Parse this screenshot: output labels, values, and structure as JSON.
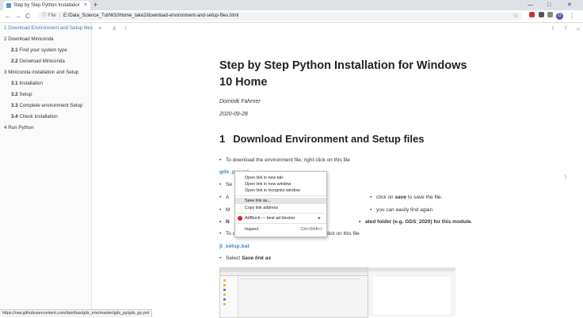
{
  "browser": {
    "tab_title": "Step by Step Python Installation for",
    "tab_close": "×",
    "new_tab": "+",
    "win_min": "—",
    "win_max": "□",
    "win_close": "✕",
    "back": "←",
    "forward": "→",
    "reload": "C",
    "info": "ⓘ",
    "file_label": "File",
    "url": "E:/Data_Science_Tut/W10Home_take2/download-environment-and-setup-files.html",
    "star": "☆",
    "avatar_letter": "D",
    "menu": "⋮"
  },
  "sidebar": {
    "items": [
      {
        "num": "1",
        "label": "Download Environment and Setup files"
      },
      {
        "num": "2",
        "label": "Download Miniconda"
      },
      {
        "num": "2.1",
        "label": "Find your system type"
      },
      {
        "num": "2.2",
        "label": "Donwload Miniconda"
      },
      {
        "num": "3",
        "label": "Miniconda installation and Setup"
      },
      {
        "num": "3.1",
        "label": "Installation"
      },
      {
        "num": "3.2",
        "label": "Setup"
      },
      {
        "num": "3.3",
        "label": "Complete environment Setup"
      },
      {
        "num": "3.4",
        "label": "Check installation"
      },
      {
        "num": "4",
        "label": "Run Python"
      }
    ]
  },
  "book_header": {
    "menu_icon": "≡",
    "font_icon": "A",
    "info_icon": "i",
    "twitter_icon": "t",
    "facebook_icon": "f",
    "share_icon": "≺"
  },
  "content": {
    "title": "Step by Step Python Installation for Windows 10 Home",
    "author": "Dominik Fahrner",
    "date": "2020-09-28",
    "h1_num": "1",
    "h1": "Download Environment and Setup files",
    "bullet1": "To download the environment file, right click on this file",
    "link1": "gds_py.yml",
    "bullet2_start": "Se",
    "bullet3_start": "A",
    "bullet3_end_a": "click on ",
    "bullet3_end_b": "save",
    "bullet3_end_c": " to save the file.",
    "bullet4_start": "M",
    "bullet4_end": "you can easily find again",
    "bullet5_start": "N",
    "bullet5_end": "ated folder (e.g. GDS_2020) for this module.",
    "bullet6": "To download the jupyter lab setup file, right click on this file",
    "link2": "jl_setup.bat",
    "bullet7_a": "Select ",
    "bullet7_b": "Save link as",
    "next_arrow": "›"
  },
  "context_menu": {
    "items": [
      {
        "label": "Open link in new tab",
        "kbd": ""
      },
      {
        "label": "Open link in new window",
        "kbd": ""
      },
      {
        "label": "Open link in incognito window",
        "kbd": ""
      },
      {
        "label": "Save link as...",
        "kbd": ""
      },
      {
        "label": "Copy link address",
        "kbd": ""
      },
      {
        "label": "AdBlock — best ad blocker",
        "kbd": "►"
      },
      {
        "label": "Inspect",
        "kbd": "Ctrl+Shift+I"
      }
    ]
  },
  "status_bar": {
    "url": "https://raw.githubusercontent.com/darribas/gds_env/master/gds_py/gds_py.yml"
  },
  "colors": {
    "link": "#4183c4",
    "avatar": "#5c4db1",
    "adblock": "#d92525"
  }
}
